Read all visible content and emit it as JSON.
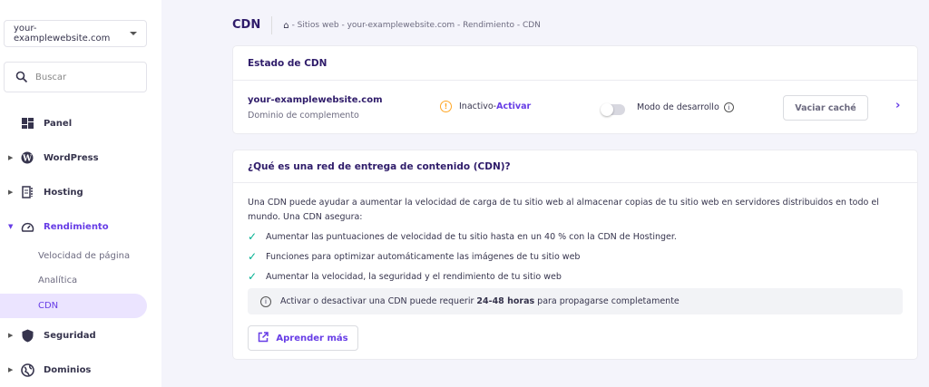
{
  "sidebar": {
    "site_select": "your-examplewebsite.com",
    "search_placeholder": "Buscar",
    "items": [
      {
        "label": "Panel"
      },
      {
        "label": "WordPress"
      },
      {
        "label": "Hosting"
      },
      {
        "label": "Rendimiento"
      },
      {
        "label": "Seguridad"
      },
      {
        "label": "Dominios"
      }
    ],
    "sub_items": [
      {
        "label": "Velocidad de página"
      },
      {
        "label": "Analítica"
      },
      {
        "label": "CDN"
      }
    ]
  },
  "header": {
    "title": "CDN",
    "breadcrumb": "- Sitios web - your-examplewebsite.com - Rendimiento - CDN"
  },
  "status_card": {
    "title": "Estado de CDN",
    "domain": "your-examplewebsite.com",
    "domain_type": "Dominio de complemento",
    "status": "Inactivo",
    "separator": " - ",
    "activate": "Activar",
    "dev_mode": "Modo de desarrollo",
    "dev_mode_on": false,
    "clear_cache": "Vaciar caché"
  },
  "info_card": {
    "title": "¿Qué es una red de entrega de contenido (CDN)?",
    "intro": "Una CDN puede ayudar a aumentar la velocidad de carga de tu sitio web al almacenar copias de tu sitio web en servidores distribuidos en todo el mundo. Una CDN asegura:",
    "benefits": [
      "Aumentar las puntuaciones de velocidad de tu sitio hasta en un 40 % con la CDN de Hostinger.",
      "Funciones para optimizar automáticamente las imágenes de tu sitio web",
      "Aumentar la velocidad, la seguridad y el rendimiento de tu sitio web"
    ],
    "notice_pre": "Activar o desactivar una CDN puede requerir ",
    "notice_bold": "24-48 horas",
    "notice_post": " para propagarse completamente",
    "learn_more": "Aprender más"
  },
  "colors": {
    "accent": "#673de6",
    "warning": "#ffa726",
    "check": "#00b090"
  }
}
